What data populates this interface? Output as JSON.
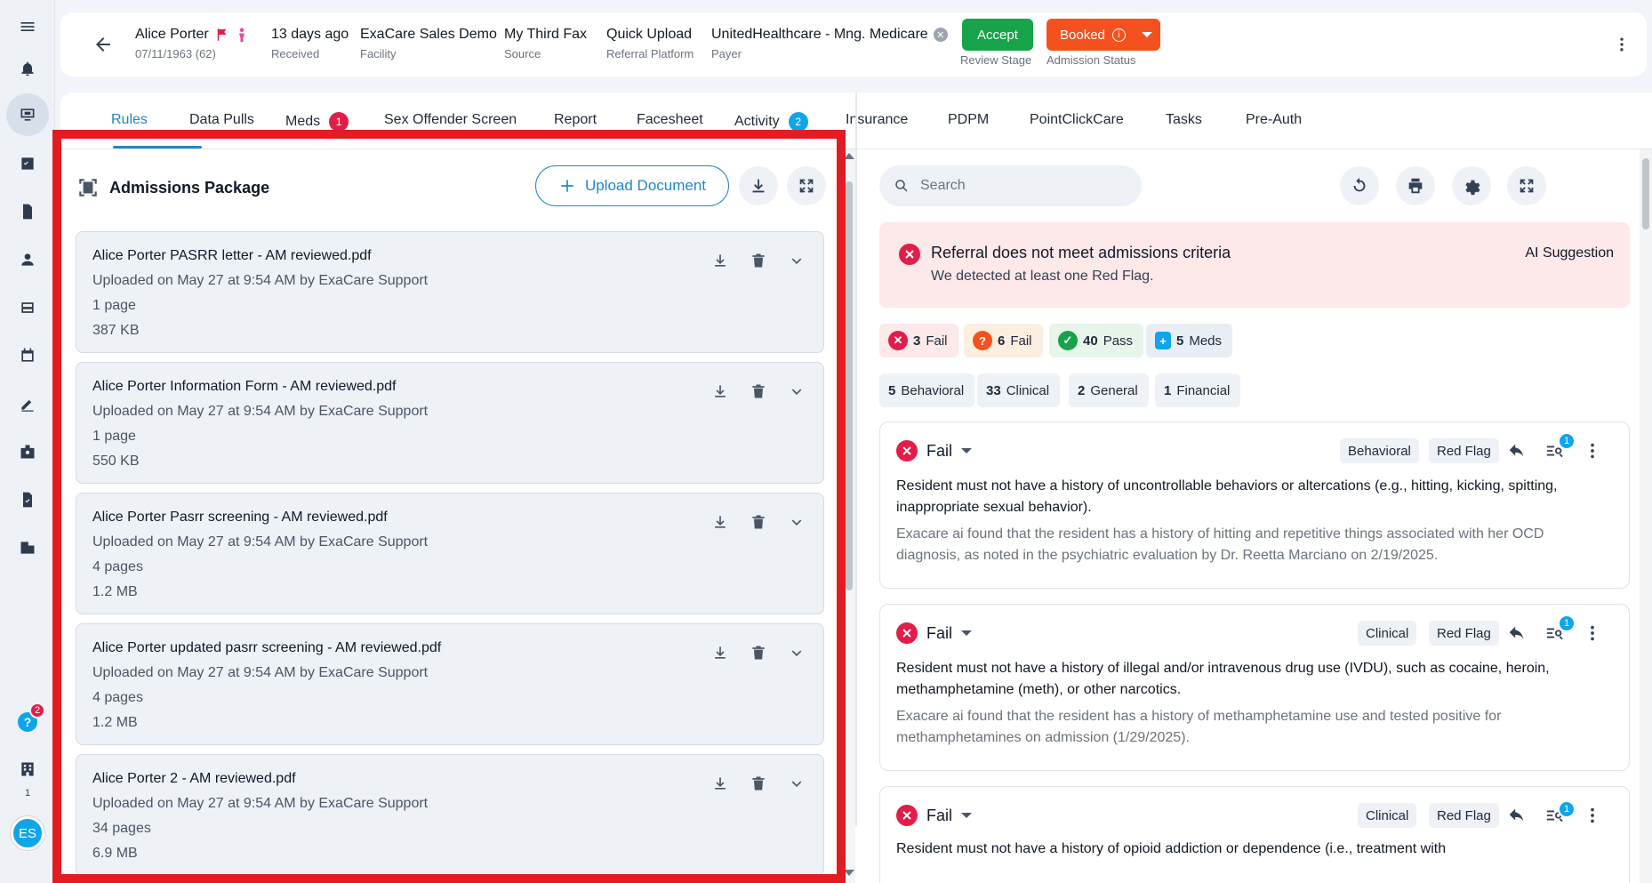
{
  "rail": {
    "items": [
      "menu-icon",
      "bell-icon",
      "monitor-icon",
      "checklist-icon",
      "document-icon",
      "person-icon",
      "bed-icon",
      "calendar-icon",
      "pen-icon",
      "badge-icon",
      "file-check-icon",
      "building-icon"
    ],
    "help_badge": "2",
    "org_count": "1",
    "avatar": "ES"
  },
  "header": {
    "patient_name": "Alice Porter",
    "patient_dob": "07/11/1963 (62)",
    "received_value": "13 days ago",
    "received_label": "Received",
    "facility_value": "ExaCare Sales Demo",
    "facility_label": "Facility",
    "source_value": "My Third Fax",
    "source_label": "Source",
    "platform_value": "Quick Upload",
    "platform_label": "Referral Platform",
    "payer_value": "UnitedHealthcare - Mng. Medicare",
    "payer_label": "Payer",
    "accept_label": "Accept",
    "review_stage_label": "Review Stage",
    "booked_label": "Booked",
    "admission_status_label": "Admission Status"
  },
  "tabs": [
    {
      "label": "Rules"
    },
    {
      "label": "Data Pulls"
    },
    {
      "label": "Meds",
      "badge": "1"
    },
    {
      "label": "Sex Offender Screen"
    },
    {
      "label": "Report"
    },
    {
      "label": "Facesheet"
    },
    {
      "label": "Activity",
      "badge": "2"
    },
    {
      "label": "Insurance"
    },
    {
      "label": "PDPM"
    },
    {
      "label": "PointClickCare"
    },
    {
      "label": "Tasks"
    },
    {
      "label": "Pre-Auth"
    }
  ],
  "docs": {
    "title": "Admissions Package",
    "upload_label": "Upload Document",
    "items": [
      {
        "name": "Alice Porter PASRR letter - AM reviewed.pdf",
        "uploaded": "Uploaded on May 27 at 9:54 AM by ExaCare Support",
        "pages": "1 page",
        "size": "387 KB"
      },
      {
        "name": "Alice Porter Information Form - AM reviewed.pdf",
        "uploaded": "Uploaded on May 27 at 9:54 AM by ExaCare Support",
        "pages": "1 page",
        "size": "550 KB"
      },
      {
        "name": "Alice Porter Pasrr screening - AM reviewed.pdf",
        "uploaded": "Uploaded on May 27 at 9:54 AM by ExaCare Support",
        "pages": "4 pages",
        "size": "1.2 MB"
      },
      {
        "name": "Alice Porter updated pasrr screening - AM reviewed.pdf",
        "uploaded": "Uploaded on May 27 at 9:54 AM by ExaCare Support",
        "pages": "4 pages",
        "size": "1.2 MB"
      },
      {
        "name": "Alice Porter 2 - AM reviewed.pdf",
        "uploaded": "Uploaded on May 27 at 9:54 AM by ExaCare Support",
        "pages": "34 pages",
        "size": "6.9 MB"
      }
    ]
  },
  "rules": {
    "search_placeholder": "Search",
    "alert_title": "Referral does not meet admissions criteria",
    "alert_text": "We detected at least one Red Flag.",
    "alert_tag": "AI Suggestion",
    "summary": {
      "red_fail_count": "3",
      "red_fail_label": "Fail",
      "orange_fail_count": "6",
      "orange_fail_label": "Fail",
      "pass_count": "40",
      "pass_label": "Pass",
      "meds_count": "5",
      "meds_label": "Meds"
    },
    "categories": [
      {
        "count": "5",
        "label": "Behavioral"
      },
      {
        "count": "33",
        "label": "Clinical"
      },
      {
        "count": "2",
        "label": "General"
      },
      {
        "count": "1",
        "label": "Financial"
      }
    ],
    "cards": [
      {
        "status": "Fail",
        "category": "Behavioral",
        "flag": "Red Flag",
        "count": "1",
        "text": "Resident must not have a history of uncontrollable behaviors or altercations (e.g., hitting, kicking, spitting, inappropriate sexual behavior).",
        "note": "Exacare ai found that the resident has a history of hitting and repetitive things associated with her OCD diagnosis, as noted in the psychiatric evaluation by Dr. Reetta Marciano on 2/19/2025."
      },
      {
        "status": "Fail",
        "category": "Clinical",
        "flag": "Red Flag",
        "count": "1",
        "text": "Resident must not have a history of illegal and/or intravenous drug use (IVDU), such as cocaine, heroin, methamphetamine (meth), or other narcotics.",
        "note": "Exacare ai found that the resident has a history of methamphetamine use and tested positive for methamphetamines on admission (1/29/2025)."
      },
      {
        "status": "Fail",
        "category": "Clinical",
        "flag": "Red Flag",
        "count": "1",
        "text": "Resident must not have a history of opioid addiction or dependence (i.e., treatment with",
        "note": ""
      }
    ]
  },
  "colors": {
    "accent": "#1e88c7",
    "accept": "#16a34a",
    "booked": "#f4511e",
    "fail": "#e11d48",
    "highlight": "#e31b23"
  }
}
